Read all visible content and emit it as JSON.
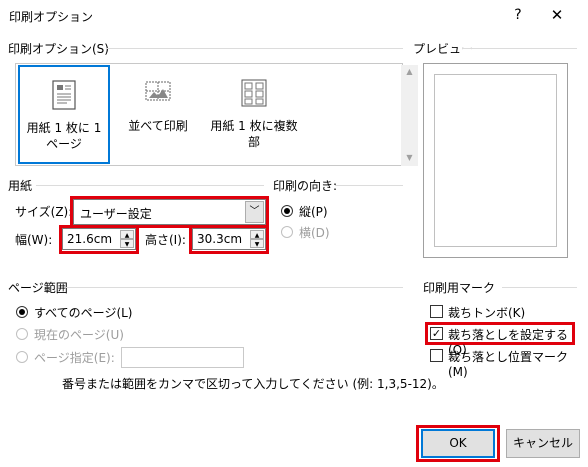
{
  "window": {
    "title": "印刷オプション",
    "help": "?",
    "close": "✕"
  },
  "print_options": {
    "label": "印刷オプション(S)",
    "items": [
      {
        "label": "用紙 1 枚に 1 ページ",
        "icon": "single-page-icon",
        "selected": true
      },
      {
        "label": "並べて印刷",
        "icon": "tile-print-icon",
        "selected": false
      },
      {
        "label": "用紙 1 枚に複数部",
        "icon": "multiple-copies-icon",
        "selected": false
      }
    ]
  },
  "preview": {
    "label": "プレビュー"
  },
  "paper": {
    "label": "用紙",
    "size_label": "サイズ(Z):",
    "size_value": "ユーザー設定",
    "width_label": "幅(W):",
    "width_value": "21.6cm",
    "height_label": "高さ(I):",
    "height_value": "30.3cm"
  },
  "orientation": {
    "label": "印刷の向き:",
    "portrait": "縦(P)",
    "landscape": "横(D)",
    "selected": "portrait"
  },
  "page_range": {
    "label": "ページ範囲",
    "all": "すべてのページ(L)",
    "current": "現在のページ(U)",
    "specified": "ページ指定(E):",
    "specified_value": "",
    "hint": "番号または範囲をカンマで区切って入力してください (例: 1,3,5-12)。"
  },
  "print_marks": {
    "label": "印刷用マーク",
    "crop_marks": {
      "label": "裁ちトンボ(K)",
      "checked": false
    },
    "bleed": {
      "label": "裁ち落としを設定する(Q)",
      "checked": true
    },
    "bleed_marks": {
      "label": "裁ち落とし位置マーク(M)",
      "checked": false
    }
  },
  "buttons": {
    "ok": "OK",
    "cancel": "キャンセル"
  },
  "colors": {
    "highlight": "#e0000c",
    "accent": "#0078d7"
  }
}
